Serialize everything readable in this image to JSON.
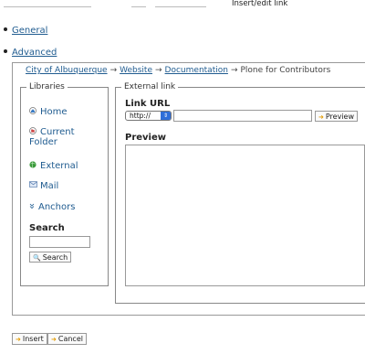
{
  "window": {
    "title": "Insert/edit link"
  },
  "top_nav": {
    "items": [
      {
        "label": "General"
      },
      {
        "label": "Advanced"
      }
    ]
  },
  "breadcrumb": {
    "items": [
      "City of Albuquerque",
      "Website",
      "Documentation"
    ],
    "current": "Plone for Contributors",
    "separator": "→"
  },
  "libraries": {
    "legend": "Libraries",
    "items": [
      {
        "label": "Home",
        "icon": "home-icon"
      },
      {
        "label": "Current",
        "label2": "Folder",
        "icon": "current-folder-icon"
      },
      {
        "label": "External",
        "icon": "globe-icon"
      },
      {
        "label": "Mail",
        "icon": "mail-icon"
      },
      {
        "label": "Anchors",
        "icon": "anchor-icon"
      }
    ],
    "search_heading": "Search",
    "search_value": "",
    "search_button": "Search"
  },
  "external": {
    "legend": "External link",
    "link_url_label": "Link URL",
    "protocol": "http://",
    "url_value": "",
    "preview_button": "Preview",
    "preview_label": "Preview"
  },
  "actions": {
    "insert": "Insert",
    "cancel": "Cancel"
  },
  "colors": {
    "link": "#205c90",
    "accent_button_icon": "#e39b00",
    "select_arrow": "#2f6ed8"
  }
}
